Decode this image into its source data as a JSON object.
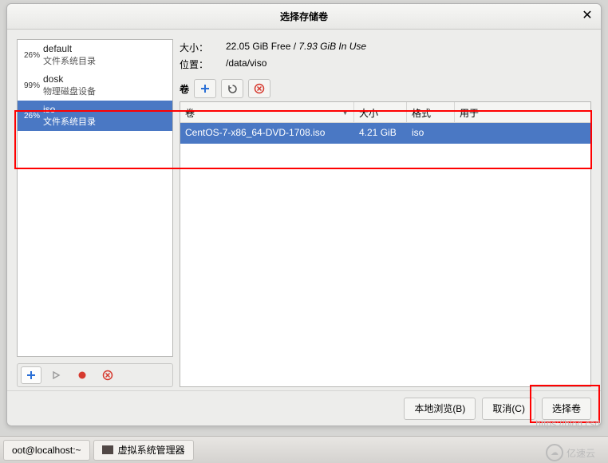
{
  "dialog": {
    "title": "选择存储卷",
    "pools": [
      {
        "percent": "26%",
        "name": "default",
        "sub": "文件系统目录",
        "selected": false
      },
      {
        "percent": "99%",
        "name": "dosk",
        "sub": "物理磁盘设备",
        "selected": false
      },
      {
        "percent": "26%",
        "name": "iso",
        "sub": "文件系统目录",
        "selected": true
      }
    ],
    "info": {
      "size_label": "大小：",
      "size_value": "22.05 GiB Free / ",
      "size_inuse": "7.93 GiB In Use",
      "location_label": "位置：",
      "location_value": "/data/viso"
    },
    "vol_bar_label": "卷",
    "table": {
      "headers": {
        "volume": "卷",
        "size": "大小",
        "format": "格式",
        "used_by": "用于"
      },
      "rows": [
        {
          "volume": "CentOS-7-x86_64-DVD-1708.iso",
          "size": "4.21 GiB",
          "format": "iso",
          "used_by": "",
          "selected": true
        }
      ]
    },
    "buttons": {
      "browse_local": "本地浏览(B)",
      "cancel": "取消(C)",
      "choose": "选择卷"
    }
  },
  "taskbar": {
    "item1": "oot@localhost:~",
    "item2": "虚拟系统管理器"
  },
  "watermark": {
    "host": "https://blog.csd",
    "brand": "亿速云"
  }
}
